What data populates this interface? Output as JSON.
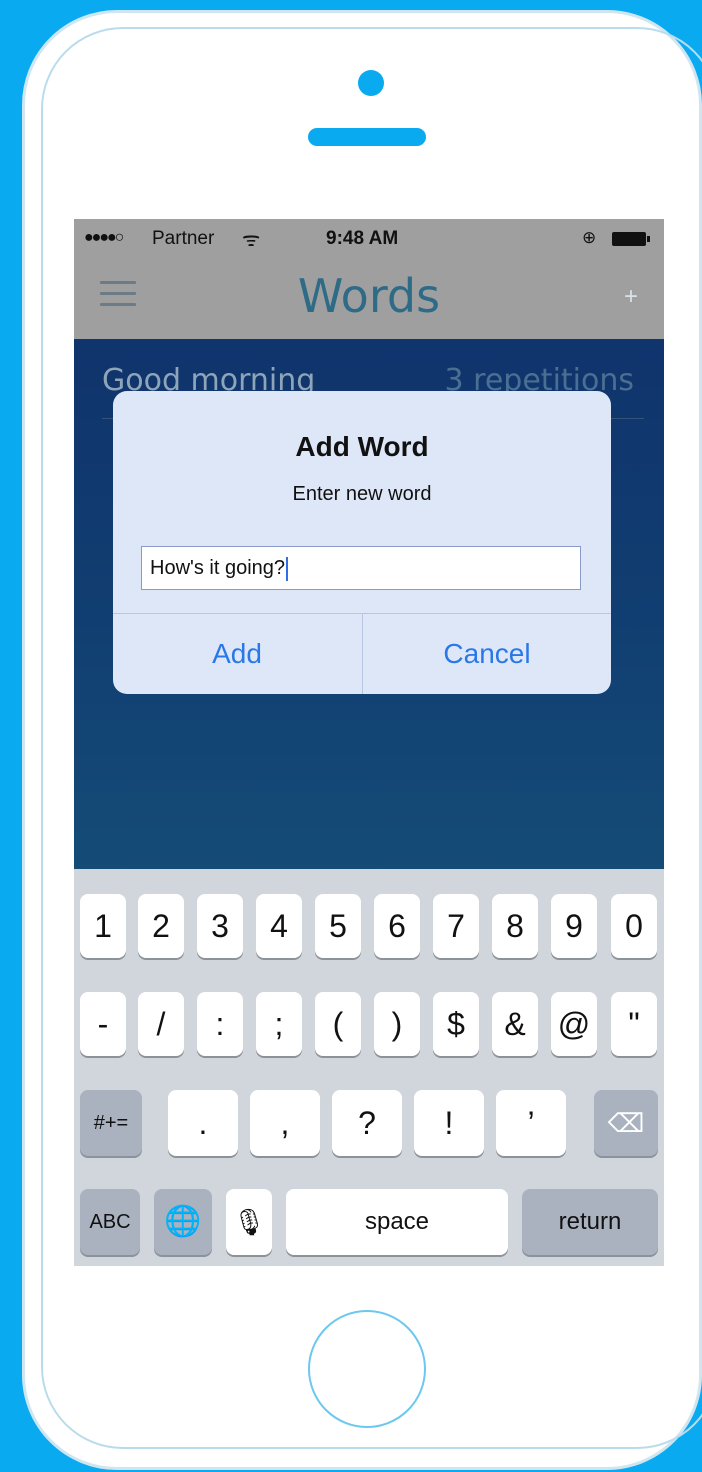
{
  "status_bar": {
    "signal": "●●●●○",
    "carrier": "Partner",
    "wifi_icon": "wifi-icon",
    "time": "9:48 AM",
    "lock_icon": "⊕",
    "battery_icon": "battery-icon"
  },
  "nav": {
    "title": "Words",
    "menu_icon": "hamburger-icon",
    "add_label": "+"
  },
  "list": {
    "rows": [
      {
        "word": "Good morning",
        "count": "3 repetitions"
      }
    ]
  },
  "alert": {
    "title": "Add Word",
    "message": "Enter new word",
    "input_value": "How's it going?",
    "add_label": "Add",
    "cancel_label": "Cancel"
  },
  "keyboard": {
    "row1": [
      "1",
      "2",
      "3",
      "4",
      "5",
      "6",
      "7",
      "8",
      "9",
      "0"
    ],
    "row2": [
      "-",
      "/",
      ":",
      ";",
      "(",
      ")",
      "$",
      "&",
      "@",
      "\""
    ],
    "row3_mode": "#+=",
    "row3": [
      ".",
      ",",
      "?",
      "!",
      "’"
    ],
    "backspace_icon": "⌫",
    "abc": "ABC",
    "globe_icon": "🌐",
    "mic_icon": "🎙",
    "space": "space",
    "return": "return"
  },
  "colors": {
    "background": "#0aaaf0",
    "nav_bar": "#9f9f9f",
    "title": "#2e6b86",
    "alert_button": "#2a78e8"
  }
}
